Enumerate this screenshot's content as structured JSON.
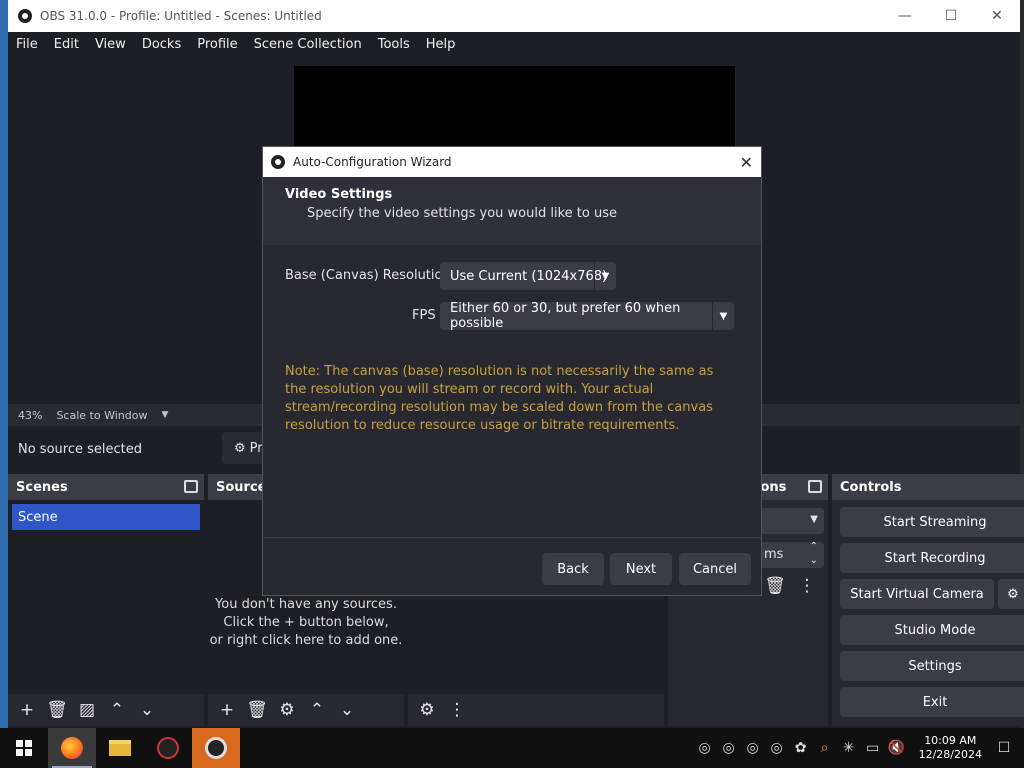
{
  "window": {
    "title": "OBS 31.0.0 - Profile: Untitled - Scenes: Untitled"
  },
  "menu": [
    "File",
    "Edit",
    "View",
    "Docks",
    "Profile",
    "Scene Collection",
    "Tools",
    "Help"
  ],
  "scalebar": {
    "zoom": "43%",
    "mode": "Scale to Window"
  },
  "sourcebar": {
    "status": "No source selected",
    "properties_label": "Pr"
  },
  "scenes": {
    "title": "Scenes",
    "items": [
      "Scene"
    ]
  },
  "sources": {
    "title": "Source",
    "empty_lines": [
      "You don't have any sources.",
      "Click the + button below,",
      "or right click here to add one."
    ]
  },
  "transitions": {
    "title_fragment": "ions",
    "duration_fragment": "ms"
  },
  "controls": {
    "title": "Controls",
    "start_streaming": "Start Streaming",
    "start_recording": "Start Recording",
    "start_virtual_camera": "Start Virtual Camera",
    "studio_mode": "Studio Mode",
    "settings": "Settings",
    "exit": "Exit"
  },
  "dialog": {
    "title": "Auto-Configuration Wizard",
    "heading": "Video Settings",
    "subheading": "Specify the video settings you would like to use",
    "resolution_label": "Base (Canvas) Resolution",
    "resolution_value": "Use Current (1024x768)",
    "fps_label": "FPS",
    "fps_value": "Either 60 or 30, but prefer 60 when possible",
    "note": "Note: The canvas (base) resolution is not necessarily the same as the resolution you will stream or record with. Your actual stream/recording resolution may be scaled down from the canvas resolution to reduce resource usage or bitrate requirements.",
    "back": "Back",
    "next": "Next",
    "cancel": "Cancel"
  },
  "taskbar": {
    "time": "10:09 AM",
    "date": "12/28/2024"
  },
  "colors": {
    "accent": "#2f56c6",
    "note": "#c9a13f",
    "obs_taskbar": "#d86a1e"
  }
}
